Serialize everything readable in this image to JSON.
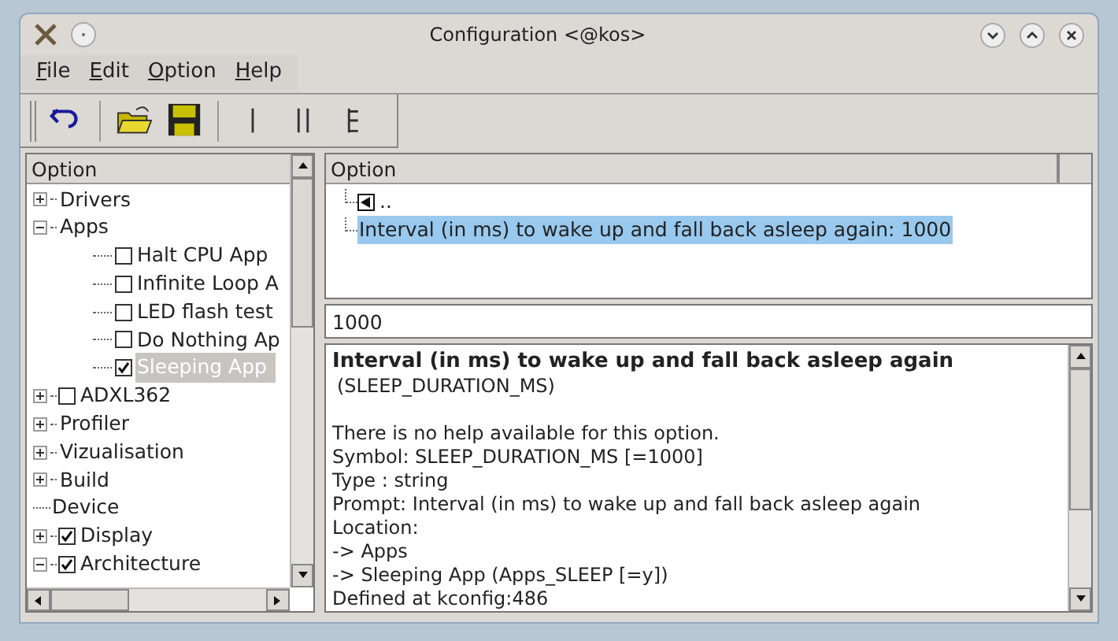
{
  "window": {
    "title": "Configuration <@kos>"
  },
  "menu": [
    {
      "label": "File"
    },
    {
      "label": "Edit"
    },
    {
      "label": "Option"
    },
    {
      "label": "Help"
    }
  ],
  "toolbar": [
    {
      "kind": "back"
    },
    {
      "kind": "sep"
    },
    {
      "kind": "open"
    },
    {
      "kind": "save"
    },
    {
      "kind": "sep"
    },
    {
      "kind": "single"
    },
    {
      "kind": "split"
    },
    {
      "kind": "full"
    }
  ],
  "left_tree": {
    "column": "Option",
    "items": [
      {
        "label": "Drivers",
        "kind": "menu",
        "expanded": false,
        "selected": false
      },
      {
        "label": "Apps",
        "kind": "menu",
        "expanded": true,
        "selected": false,
        "children": [
          {
            "label": "Halt CPU App",
            "kind": "bool",
            "checked": false,
            "selected": false
          },
          {
            "label": "Infinite Loop A",
            "kind": "bool",
            "checked": false,
            "selected": false
          },
          {
            "label": "LED flash test",
            "kind": "bool",
            "checked": false,
            "selected": false
          },
          {
            "label": "Do Nothing Ap",
            "kind": "bool",
            "checked": false,
            "selected": false
          },
          {
            "label": "Sleeping App",
            "kind": "bool",
            "checked": true,
            "selected": true
          }
        ]
      },
      {
        "label": "ADXL362",
        "kind": "boolmenu",
        "expanded": false,
        "checked": false,
        "selected": false
      },
      {
        "label": "Profiler",
        "kind": "menu",
        "expanded": false,
        "selected": false
      },
      {
        "label": "Vizualisation",
        "kind": "menu",
        "expanded": false,
        "selected": false
      },
      {
        "label": "Build",
        "kind": "menu",
        "expanded": false,
        "selected": false
      },
      {
        "label": "Device",
        "kind": "comment",
        "selected": false
      },
      {
        "label": "Display",
        "kind": "boolmenu",
        "expanded": false,
        "checked": true,
        "selected": false
      },
      {
        "label": "Architecture",
        "kind": "boolmenu",
        "expanded": true,
        "checked": true,
        "selected": false
      }
    ]
  },
  "right_list": {
    "column": "Option",
    "items": [
      {
        "label": "..",
        "kind": "back",
        "selected": false
      },
      {
        "label": "Interval (in ms) to wake up and fall back asleep again: 1000",
        "kind": "string",
        "selected": true
      }
    ]
  },
  "value_field": {
    "value": "1000"
  },
  "info": {
    "title": "Interval (in ms) to wake up and fall back asleep again",
    "symbol": "(SLEEP_DURATION_MS)",
    "lines": [
      "There is no help available for this option.",
      "Symbol: SLEEP_DURATION_MS [=1000]",
      "Type : string",
      "Prompt: Interval (in ms) to wake up and fall back asleep again",
      "Location:",
      "-> Apps",
      "-> Sleeping App (Apps_SLEEP [=y])",
      "Defined at kconfig:486"
    ]
  }
}
